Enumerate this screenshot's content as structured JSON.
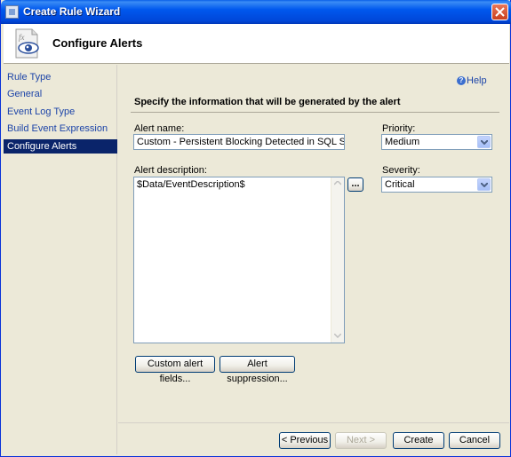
{
  "window": {
    "title": "Create Rule Wizard"
  },
  "header": {
    "title": "Configure Alerts"
  },
  "sidebar": {
    "items": [
      {
        "label": "Rule Type"
      },
      {
        "label": "General"
      },
      {
        "label": "Event Log Type"
      },
      {
        "label": "Build Event Expression"
      },
      {
        "label": "Configure Alerts",
        "active": true
      }
    ]
  },
  "main": {
    "help_label": "Help",
    "section_heading": "Specify the information that will be generated by the alert",
    "alert_name_label": "Alert name:",
    "alert_name_value": "Custom - Persistent Blocking Detected in SQL Server Databas",
    "priority_label": "Priority:",
    "priority_value": "Medium",
    "alert_description_label": "Alert description:",
    "alert_description_value": "$Data/EventDescription$",
    "ellipsis_label": "...",
    "severity_label": "Severity:",
    "severity_value": "Critical",
    "custom_fields_label": "Custom alert fields...",
    "suppression_label": "Alert suppression..."
  },
  "footer": {
    "previous_label": "< Previous",
    "next_label": "Next >",
    "create_label": "Create",
    "cancel_label": "Cancel"
  },
  "colors": {
    "accent": "#0a246a",
    "link": "#1c44a8",
    "titlebar": "#0058ee"
  }
}
